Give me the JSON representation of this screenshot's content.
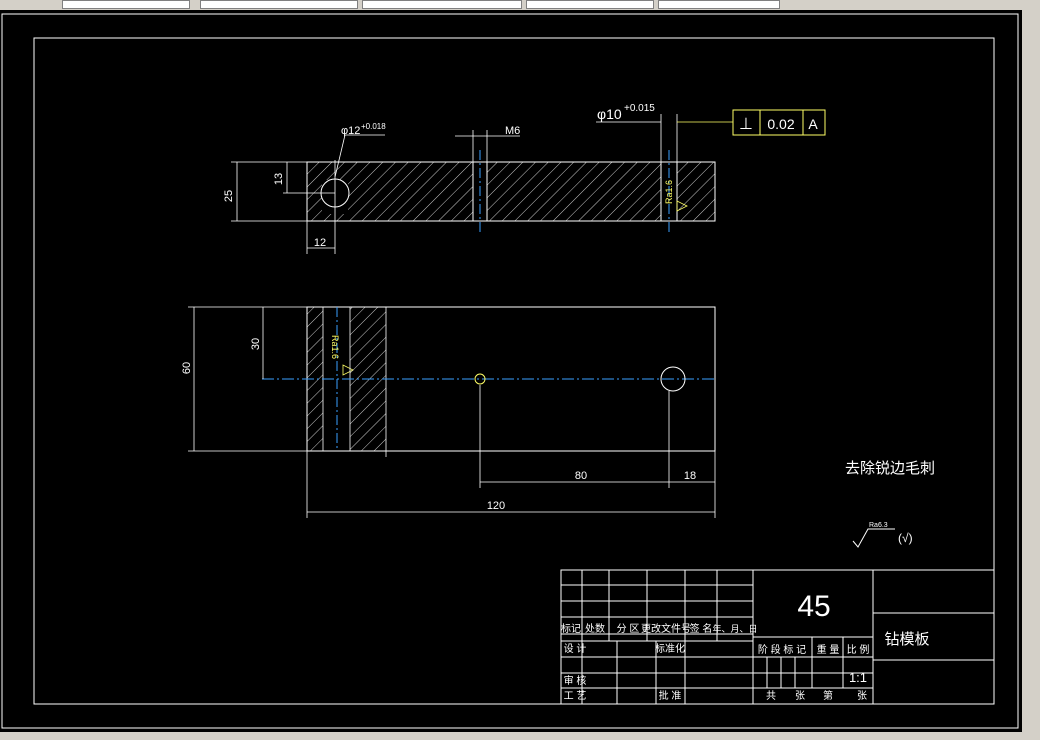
{
  "drawing": {
    "title_material": "45",
    "part_name": "钻模板",
    "note": "去除锐边毛刺",
    "roughness_symbol": "Ra6.3",
    "roughness_suffix": "(√)",
    "scale_value": "1:1"
  },
  "dimensions": {
    "hole_top_tol": "φ12",
    "hole_top_tol_sup": "+0.018",
    "hole_right": "φ10",
    "hole_right_tol": "+0.015",
    "thread": "M6",
    "height_25": "25",
    "height_13": "13",
    "width_12": "12",
    "height_60": "60",
    "height_30": "30",
    "len_80": "80",
    "len_18": "18",
    "len_120": "120",
    "ra_left": "Ra1.6",
    "ra_right": "Ra1.6"
  },
  "tolerance_frame": {
    "symbol": "⊥",
    "value": "0.02",
    "datum": "A"
  },
  "title_block": {
    "rev_headers": [
      "标记",
      "处数",
      "分 区",
      "更改文件号",
      "签 名",
      "年、月、日"
    ],
    "design": "设 计",
    "standard": "标准化",
    "review": "审 核",
    "process": "工 艺",
    "approve": "批 准",
    "stage_mark": "阶 段 标 记",
    "weight": "重 量",
    "ratio": "比 例",
    "sheets": "共",
    "sheets_unit": "张",
    "sheet_no": "第",
    "sheet_unit": "张"
  }
}
